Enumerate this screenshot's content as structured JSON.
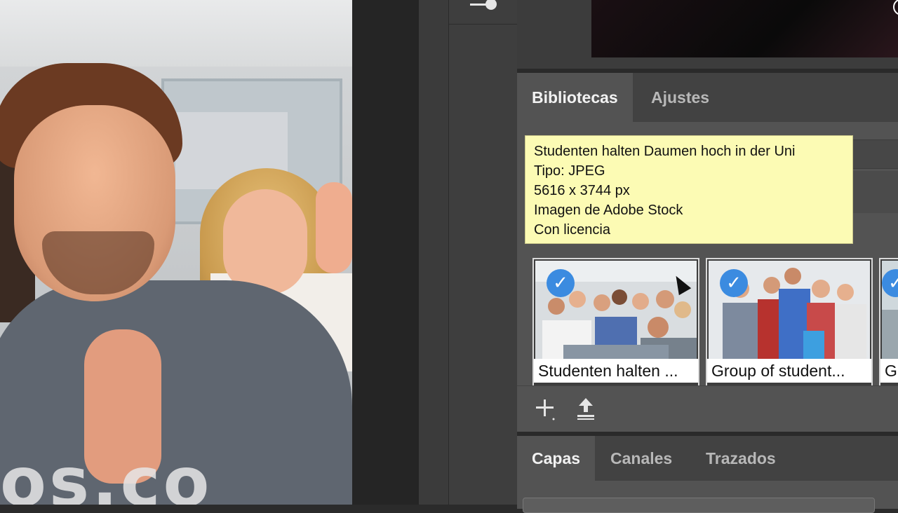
{
  "canvas": {
    "watermark": "os.co"
  },
  "libraries_panel": {
    "tabs": [
      {
        "label": "Bibliotecas",
        "active": true
      },
      {
        "label": "Ajustes",
        "active": false
      }
    ],
    "tooltip": {
      "title": "Studenten halten Daumen hoch in der Uni",
      "type": "Tipo: JPEG",
      "dimensions": "5616 x 3744 px",
      "source": "Imagen de Adobe Stock",
      "license": "Con licencia"
    },
    "assets": [
      {
        "caption": "Studenten halten ...",
        "checked": true
      },
      {
        "caption": "Group of student...",
        "checked": true
      },
      {
        "caption": "G",
        "checked": true
      }
    ],
    "toolbar": {
      "add_icon": "plus-icon",
      "upload_icon": "upload-icon"
    }
  },
  "layers_panel": {
    "tabs": [
      {
        "label": "Capas",
        "active": true
      },
      {
        "label": "Canales",
        "active": false
      },
      {
        "label": "Trazados",
        "active": false
      }
    ]
  },
  "colors": {
    "tooltip_bg": "#fcfbb4",
    "check_blue": "#3b8be0",
    "panel_bg": "#535353"
  }
}
